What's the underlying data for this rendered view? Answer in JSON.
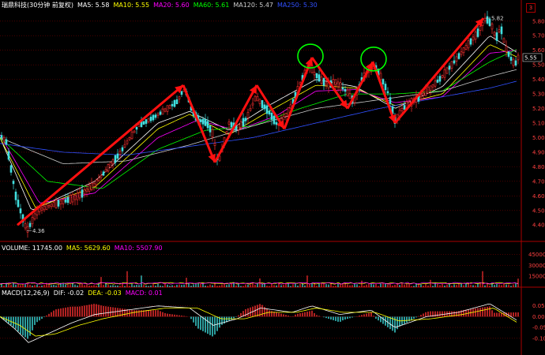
{
  "header": {
    "stock_title": "瑞鼎科技(30分钟 前复权)",
    "ma_items": [
      {
        "label": "MA5: 5.58",
        "color": "#ffffff"
      },
      {
        "label": "MA10: 5.55",
        "color": "#ffff00"
      },
      {
        "label": "MA20: 5.60",
        "color": "#ff00ff"
      },
      {
        "label": "MA60: 5.61",
        "color": "#00ff00"
      },
      {
        "label": "MA120: 5.47",
        "color": "#cccccc"
      },
      {
        "label": "MA250: 5.30",
        "color": "#3050ff"
      }
    ],
    "badge": "3"
  },
  "volume_header": {
    "items": [
      {
        "label": "VOLUME: 11745.00",
        "color": "#ffffff"
      },
      {
        "label": "MA5: 5629.60",
        "color": "#ffff00"
      },
      {
        "label": "MA10: 5507.90",
        "color": "#ff00ff"
      }
    ]
  },
  "macd_header": {
    "items": [
      {
        "label": "MACD(12,26,9)",
        "color": "#ffffff"
      },
      {
        "label": "DIF: -0.02",
        "color": "#ffffff"
      },
      {
        "label": "DEA: -0.03",
        "color": "#ffff00"
      },
      {
        "label": "MACD: 0.01",
        "color": "#ff00ff"
      }
    ]
  },
  "colors": {
    "up": "#ff3030",
    "down": "#40e0e0",
    "grid": "#7a0000",
    "axis_text": "#ff4040",
    "arrow": "#ff1010",
    "circle": "#00ff00"
  },
  "chart_data": [
    {
      "type": "candlestick",
      "title": "瑞鼎科技(30分钟 前复权)",
      "ylim": [
        4.32,
        5.88
      ],
      "yticks": [
        "5.80",
        "5.70",
        "5.60",
        "5.50",
        "5.40",
        "5.30",
        "5.20",
        "5.10",
        "5.00",
        "4.90",
        "4.80",
        "4.70",
        "4.60",
        "4.50",
        "4.40"
      ],
      "price_path": {
        "x": [
          0,
          8,
          20,
          34,
          48,
          62,
          80,
          100,
          120,
          150,
          175,
          198,
          212,
          225,
          232,
          237,
          243,
          252,
          262,
          270,
          276,
          282,
          290,
          300,
          312,
          324,
          340,
          352,
          365,
          372,
          382,
          392,
          398,
          406,
          415,
          425,
          438,
          448,
          458,
          468,
          475,
          482,
          492,
          500,
          510,
          520,
          532,
          545,
          560,
          575,
          590,
          605,
          615,
          622,
          628,
          634,
          640,
          646,
          652,
          656
        ],
        "y": [
          5.02,
          4.97,
          4.6,
          4.36,
          4.5,
          4.53,
          4.56,
          4.6,
          4.68,
          4.88,
          5.08,
          5.15,
          5.2,
          5.25,
          5.33,
          5.3,
          5.18,
          5.12,
          5.1,
          5.02,
          4.82,
          4.93,
          5.1,
          5.06,
          5.13,
          5.28,
          5.18,
          5.08,
          5.18,
          5.26,
          5.4,
          5.5,
          5.44,
          5.4,
          5.36,
          5.38,
          5.32,
          5.25,
          5.4,
          5.46,
          5.49,
          5.42,
          5.3,
          5.12,
          5.2,
          5.24,
          5.28,
          5.34,
          5.42,
          5.52,
          5.62,
          5.72,
          5.82,
          5.78,
          5.68,
          5.76,
          5.62,
          5.55,
          5.5,
          5.55
        ]
      },
      "annotations": [
        {
          "text": "5.82",
          "x": 615,
          "y": 5.82
        },
        {
          "text": "4.36",
          "x": 34,
          "y": 4.36
        },
        {
          "text": "5.55",
          "x": 656,
          "y": 5.55,
          "boxed": true
        }
      ],
      "ma": [
        {
          "name": "MA5",
          "color": "#ffffff",
          "x": [
            0,
            40,
            120,
            200,
            240,
            290,
            340,
            400,
            450,
            500,
            560,
            620,
            656
          ],
          "y": [
            5.0,
            4.5,
            4.7,
            5.1,
            5.18,
            5.05,
            5.22,
            5.4,
            5.35,
            5.2,
            5.35,
            5.7,
            5.58
          ]
        },
        {
          "name": "MA10",
          "color": "#ffff00",
          "x": [
            0,
            45,
            120,
            200,
            240,
            290,
            340,
            400,
            450,
            500,
            560,
            620,
            656
          ],
          "y": [
            5.0,
            4.52,
            4.66,
            5.06,
            5.16,
            5.02,
            5.18,
            5.36,
            5.34,
            5.22,
            5.3,
            5.64,
            5.55
          ]
        },
        {
          "name": "MA20",
          "color": "#ff00ff",
          "x": [
            0,
            50,
            120,
            200,
            250,
            300,
            350,
            400,
            450,
            500,
            560,
            620,
            656
          ],
          "y": [
            5.02,
            4.55,
            4.62,
            5.0,
            5.12,
            5.05,
            5.15,
            5.32,
            5.33,
            5.24,
            5.28,
            5.58,
            5.6
          ]
        },
        {
          "name": "MA60",
          "color": "#00ff00",
          "x": [
            0,
            60,
            130,
            200,
            260,
            320,
            380,
            440,
            500,
            560,
            620,
            656
          ],
          "y": [
            5.0,
            4.7,
            4.65,
            4.92,
            5.05,
            5.08,
            5.2,
            5.3,
            5.3,
            5.32,
            5.52,
            5.61
          ]
        },
        {
          "name": "MA120",
          "color": "#cccccc",
          "x": [
            0,
            80,
            160,
            240,
            320,
            400,
            480,
            560,
            620,
            656
          ],
          "y": [
            5.0,
            4.82,
            4.84,
            4.95,
            5.08,
            5.2,
            5.26,
            5.32,
            5.42,
            5.47
          ]
        },
        {
          "name": "MA250",
          "color": "#3050ff",
          "x": [
            0,
            80,
            160,
            240,
            320,
            400,
            480,
            560,
            620,
            656
          ],
          "y": [
            4.96,
            4.9,
            4.88,
            4.94,
            5.0,
            5.1,
            5.2,
            5.28,
            5.34,
            5.39
          ]
        }
      ],
      "zigzag": {
        "x": [
          22,
          232,
          272,
          325,
          360,
          395,
          440,
          472,
          500,
          612
        ],
        "y": [
          4.4,
          5.36,
          4.83,
          5.36,
          5.06,
          5.55,
          5.2,
          5.52,
          5.1,
          5.82
        ]
      },
      "circles": [
        {
          "x": 393,
          "y": 5.56
        },
        {
          "x": 473,
          "y": 5.54
        }
      ]
    },
    {
      "type": "bar",
      "title": "VOLUME",
      "ylim": [
        0,
        50000
      ],
      "yticks": [
        "45000",
        "30000",
        "15000"
      ],
      "spikes": [
        {
          "x": 128,
          "v": 14000
        },
        {
          "x": 162,
          "v": 22000
        },
        {
          "x": 180,
          "v": 16000
        },
        {
          "x": 235,
          "v": 13000
        },
        {
          "x": 330,
          "v": 12000
        },
        {
          "x": 390,
          "v": 16000
        },
        {
          "x": 458,
          "v": 9000
        },
        {
          "x": 545,
          "v": 10000
        },
        {
          "x": 612,
          "v": 22000
        },
        {
          "x": 656,
          "v": 11745
        }
      ]
    },
    {
      "type": "bar",
      "title": "MACD(12,26,9)",
      "ylim": [
        -0.17,
        0.1
      ],
      "yticks": [
        "0.05",
        "0.00",
        "-0.05",
        "-0.10"
      ],
      "dif": {
        "x": [
          0,
          20,
          36,
          60,
          90,
          120,
          160,
          200,
          240,
          270,
          300,
          330,
          370,
          395,
          430,
          470,
          500,
          540,
          580,
          620,
          656
        ],
        "y": [
          0.0,
          -0.06,
          -0.12,
          -0.08,
          -0.03,
          0.01,
          0.03,
          0.05,
          0.04,
          -0.04,
          -0.01,
          0.04,
          0.02,
          0.05,
          0.01,
          0.03,
          -0.05,
          0.0,
          0.02,
          0.06,
          -0.02
        ]
      },
      "dea": {
        "x": [
          0,
          25,
          45,
          70,
          100,
          130,
          170,
          210,
          250,
          280,
          310,
          340,
          375,
          400,
          435,
          475,
          505,
          545,
          585,
          625,
          656
        ],
        "y": [
          0.0,
          -0.04,
          -0.09,
          -0.08,
          -0.04,
          -0.01,
          0.02,
          0.04,
          0.04,
          -0.01,
          -0.01,
          0.02,
          0.02,
          0.04,
          0.02,
          0.02,
          -0.02,
          -0.01,
          0.01,
          0.04,
          -0.03
        ]
      }
    }
  ]
}
